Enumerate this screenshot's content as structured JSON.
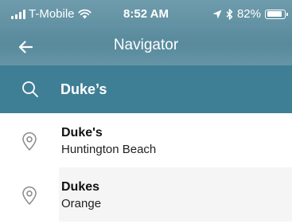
{
  "status_bar": {
    "carrier": "T-Mobile",
    "time": "8:52 AM",
    "battery": "82%",
    "battery_level": 0.82
  },
  "nav": {
    "title": "Navigator",
    "back_icon": "arrow-left-icon"
  },
  "search": {
    "icon": "search-icon",
    "value": "Duke’s"
  },
  "results": [
    {
      "name": "Duke's",
      "location": "Huntington Beach",
      "icon": "location-pin-icon"
    },
    {
      "name": "Dukes",
      "location": "Orange",
      "icon": "location-pin-icon"
    }
  ],
  "colors": {
    "header": "#5c8d9f",
    "search_bar": "#3f7f96",
    "alt_row": "#f5f5f5"
  }
}
